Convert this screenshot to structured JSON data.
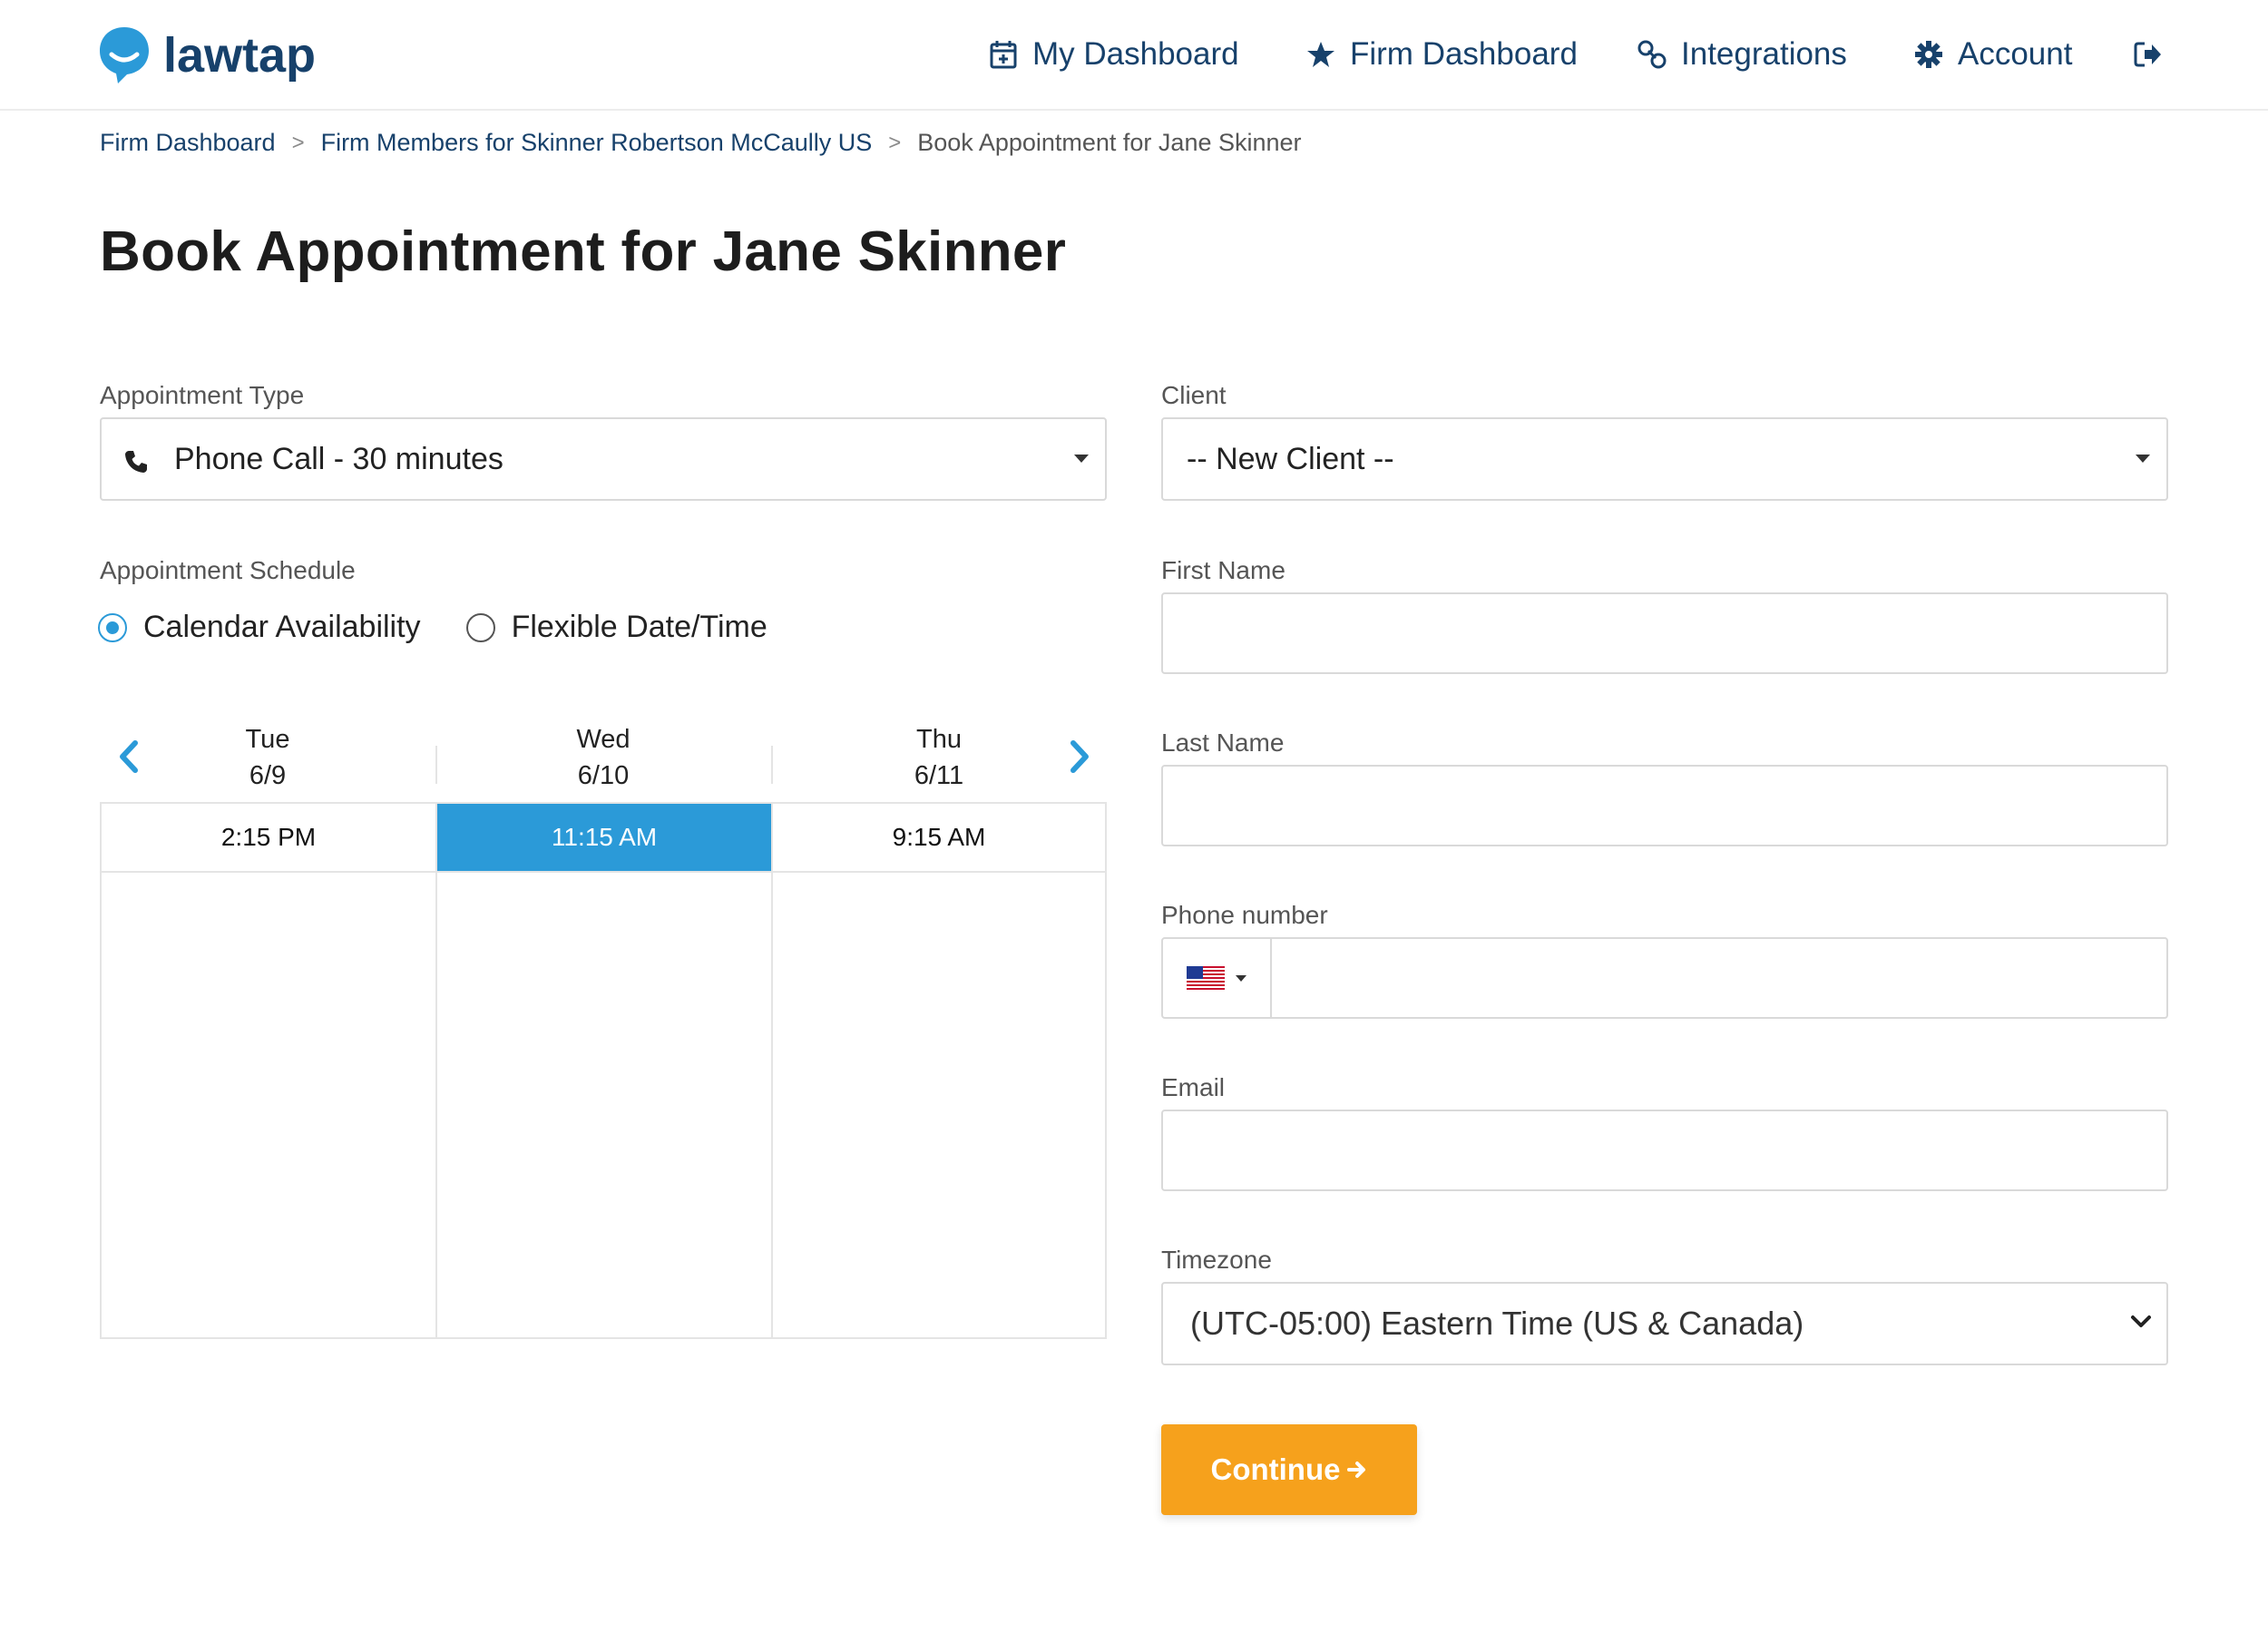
{
  "brand": {
    "name": "lawtap",
    "color": "#2b9ad8"
  },
  "nav": {
    "my_dashboard": "My Dashboard",
    "firm_dashboard": "Firm Dashboard",
    "integrations": "Integrations",
    "account": "Account",
    "icons": [
      "calendar-plus-icon",
      "star-icon",
      "link-icon",
      "gear-icon",
      "logout-icon"
    ]
  },
  "breadcrumb": {
    "items": [
      "Firm Dashboard",
      "Firm Members for Skinner Robertson McCaully US"
    ],
    "separator": ">",
    "current": "Book Appointment for Jane Skinner"
  },
  "page": {
    "title": "Book Appointment for Jane Skinner"
  },
  "appointment": {
    "type_label": "Appointment Type",
    "type_value": "Phone Call - 30 minutes",
    "schedule_label": "Appointment Schedule",
    "options": [
      "Calendar Availability",
      "Flexible Date/Time"
    ],
    "selected_option": "Calendar Availability"
  },
  "calendar": {
    "days": [
      {
        "day": "Tue",
        "date": "6/9",
        "slots": [
          "2:15 PM"
        ]
      },
      {
        "day": "Wed",
        "date": "6/10",
        "slots": [
          "11:15 AM"
        ]
      },
      {
        "day": "Thu",
        "date": "6/11",
        "slots": [
          "9:15 AM"
        ]
      }
    ],
    "selected_slot": "11:15 AM",
    "selected_color": "#2b9ad8"
  },
  "client": {
    "label": "Client",
    "value": "-- New Client --",
    "first_name_label": "First Name",
    "last_name_label": "Last Name",
    "phone_label": "Phone number",
    "email_label": "Email",
    "timezone_label": "Timezone",
    "timezone_value": "(UTC-05:00) Eastern Time (US & Canada)"
  },
  "actions": {
    "continue_label": "Continue",
    "continue_color": "#f6a11c"
  }
}
